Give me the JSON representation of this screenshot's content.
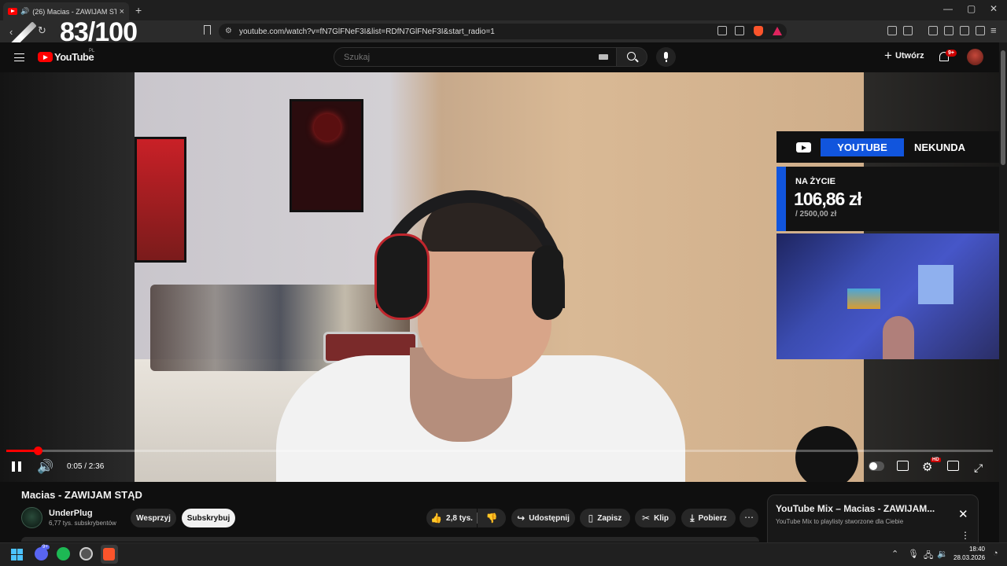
{
  "browser": {
    "tab_title": "(26) Macias - ZAWIJAM STĄD",
    "tab_audio_icon": "speaker-icon",
    "tab_close": "×",
    "new_tab": "+",
    "window_controls": [
      "—",
      "▢",
      "✕"
    ],
    "url": "youtube.com/watch?v=fN7GlFNeF3I&list=RDfN7GlFNeF3I&start_radio=1",
    "overlay_counter": "83/100"
  },
  "youtube": {
    "logo_text": "YouTube",
    "country_code": "PL",
    "search_placeholder": "Szukaj",
    "create_label": "Utwórz",
    "notifications_badge": "9+"
  },
  "stream_overlay": {
    "tab_active": "YOUTUBE",
    "tab_other": "NEKUNDA",
    "goal_label": "NA ŻYCIE",
    "goal_amount": "106,86 zł",
    "goal_target": "/ 2500,00 zł"
  },
  "player": {
    "time": "0:05 / 2:36",
    "progress_fraction": 0.032,
    "hd_badge": "HD"
  },
  "video": {
    "title": "Macias - ZAWIJAM STĄD",
    "channel_name": "UnderPlug",
    "subscribers": "6,77 tys. subskrybentów",
    "support_label": "Wesprzyj",
    "subscribe_label": "Subskrybuj",
    "likes": "2,8 tys.",
    "share_label": "Udostępnij",
    "save_label": "Zapisz",
    "clip_label": "Klip",
    "download_label": "Pobierz",
    "more_label": "⋯"
  },
  "mix_panel": {
    "title": "YouTube Mix – Macias - ZAWIJAM...",
    "subtitle": "YouTube Mix to playlisty stworzone dla Ciebie",
    "close": "✕",
    "menu": "⋮"
  },
  "taskbar": {
    "discord_badge": "9+",
    "time": "18:40",
    "date": "28.03.2026"
  },
  "colors": {
    "accent_red": "#ff0000",
    "overlay_blue": "#1155dd",
    "background": "#0f0f0f"
  }
}
